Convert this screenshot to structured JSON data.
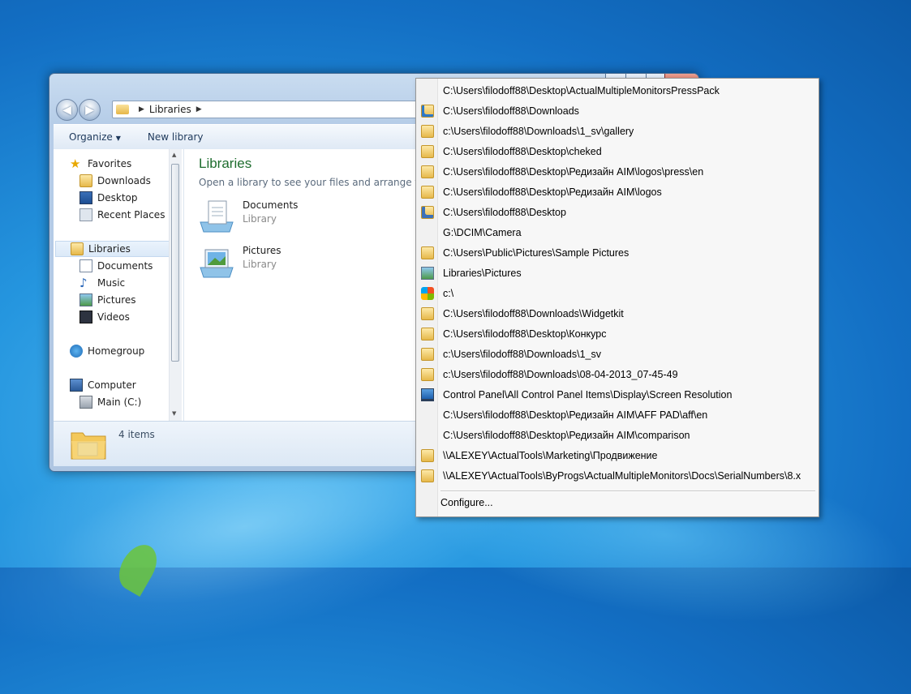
{
  "window": {
    "address": {
      "root": "Libraries"
    },
    "toolbar": {
      "organize": "Organize",
      "new_library": "New library"
    },
    "nav": {
      "favorites": "Favorites",
      "downloads": "Downloads",
      "desktop": "Desktop",
      "recent": "Recent Places",
      "libraries": "Libraries",
      "documents": "Documents",
      "music": "Music",
      "pictures": "Pictures",
      "videos": "Videos",
      "homegroup": "Homegroup",
      "computer": "Computer",
      "main_c": "Main (C:)"
    },
    "content": {
      "title": "Libraries",
      "subtitle": "Open a library to see your files and arrange them by",
      "libs": [
        {
          "name": "Documents",
          "kind": "Library"
        },
        {
          "name": "Pictures",
          "kind": "Library"
        }
      ]
    },
    "status": {
      "count": "4 items"
    }
  },
  "menu": {
    "items": [
      {
        "label": "C:\\Users\\filodoff88\\Desktop\\ActualMultipleMonitorsPressPack",
        "icon": "blank-icon"
      },
      {
        "label": "C:\\Users\\filodoff88\\Downloads",
        "icon": "downloads-folder-icon"
      },
      {
        "label": "c:\\Users\\filodoff88\\Downloads\\1_sv\\gallery",
        "icon": "folder-icon"
      },
      {
        "label": "C:\\Users\\filodoff88\\Desktop\\cheked",
        "icon": "folder-icon"
      },
      {
        "label": "C:\\Users\\filodoff88\\Desktop\\Редизайн AIM\\logos\\press\\en",
        "icon": "folder-icon"
      },
      {
        "label": "C:\\Users\\filodoff88\\Desktop\\Редизайн AIM\\logos",
        "icon": "folder-icon"
      },
      {
        "label": "C:\\Users\\filodoff88\\Desktop",
        "icon": "desktop-folder-icon"
      },
      {
        "label": "G:\\DCIM\\Camera",
        "icon": "blank-icon"
      },
      {
        "label": "C:\\Users\\Public\\Pictures\\Sample Pictures",
        "icon": "folder-icon"
      },
      {
        "label": "Libraries\\Pictures",
        "icon": "pictures-icon"
      },
      {
        "label": "c:\\",
        "icon": "windows-logo-icon"
      },
      {
        "label": "C:\\Users\\filodoff88\\Downloads\\Widgetkit",
        "icon": "folder-icon"
      },
      {
        "label": "C:\\Users\\filodoff88\\Desktop\\Конкурс",
        "icon": "folder-icon"
      },
      {
        "label": "c:\\Users\\filodoff88\\Downloads\\1_sv",
        "icon": "folder-icon"
      },
      {
        "label": "c:\\Users\\filodoff88\\Downloads\\08-04-2013_07-45-49",
        "icon": "folder-icon"
      },
      {
        "label": "Control Panel\\All Control Panel Items\\Display\\Screen Resolution",
        "icon": "monitor-icon"
      },
      {
        "label": "C:\\Users\\filodoff88\\Desktop\\Редизайн AIM\\AFF PAD\\aff\\en",
        "icon": "blank-icon"
      },
      {
        "label": "C:\\Users\\filodoff88\\Desktop\\Редизайн AIM\\comparison",
        "icon": "blank-icon"
      },
      {
        "label": "\\\\ALEXEY\\ActualTools\\Marketing\\Продвижение",
        "icon": "folder-icon"
      },
      {
        "label": "\\\\ALEXEY\\ActualTools\\ByProgs\\ActualMultipleMonitors\\Docs\\SerialNumbers\\8.x",
        "icon": "folder-icon"
      }
    ],
    "configure": "Configure..."
  }
}
